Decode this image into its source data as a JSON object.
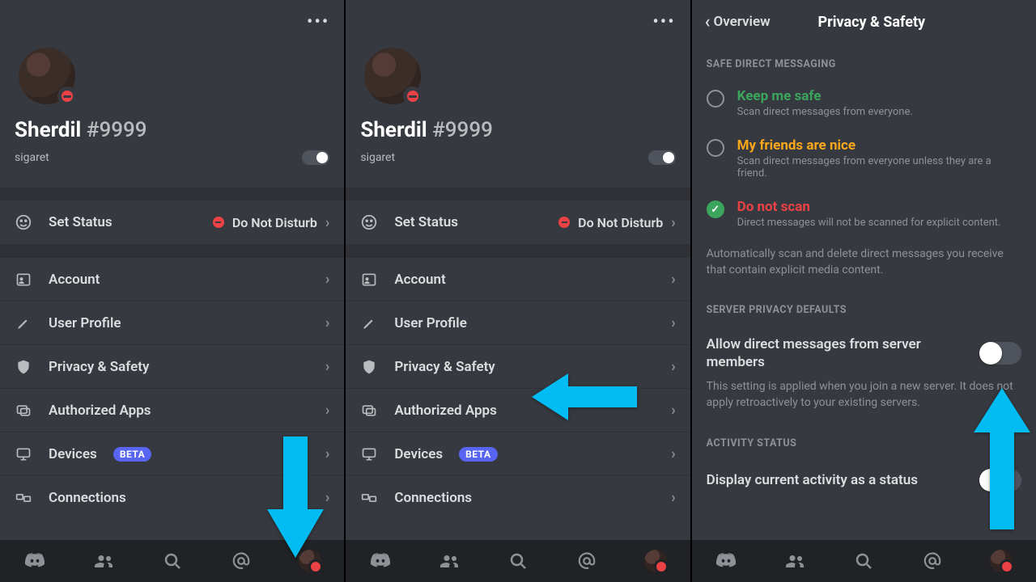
{
  "colors": {
    "accent": "#00bcf2",
    "dnd": "#ed4245",
    "beta": "#5865f2",
    "green": "#3ba55d",
    "yellow": "#faa81a"
  },
  "profile": {
    "name": "Sherdil",
    "discriminator": "#9999",
    "subtext": "sigaret"
  },
  "status_row": {
    "label": "Set Status",
    "value": "Do Not Disturb"
  },
  "rows": {
    "account": "Account",
    "userprofile": "User Profile",
    "privacy": "Privacy & Safety",
    "apps": "Authorized Apps",
    "devices": "Devices",
    "devices_badge": "BETA",
    "connections": "Connections"
  },
  "p3": {
    "back": "Overview",
    "title": "Privacy & Safety",
    "sdm_head": "SAFE DIRECT MESSAGING",
    "opt1_label": "Keep me safe",
    "opt1_desc": "Scan direct messages from everyone.",
    "opt2_label": "My friends are nice",
    "opt2_desc": "Scan direct messages from everyone unless they are a friend.",
    "opt3_label": "Do not scan",
    "opt3_desc": "Direct messages will not be scanned for explicit content.",
    "sdm_help": "Automatically scan and delete direct messages you receive that contain explicit media content.",
    "spd_head": "SERVER PRIVACY DEFAULTS",
    "spd_label": "Allow direct messages from server members",
    "spd_help": "This setting is applied when you join a new server. It does not apply retroactively to your existing servers.",
    "act_head": "ACTIVITY STATUS",
    "act_label": "Display current activity as a status"
  }
}
